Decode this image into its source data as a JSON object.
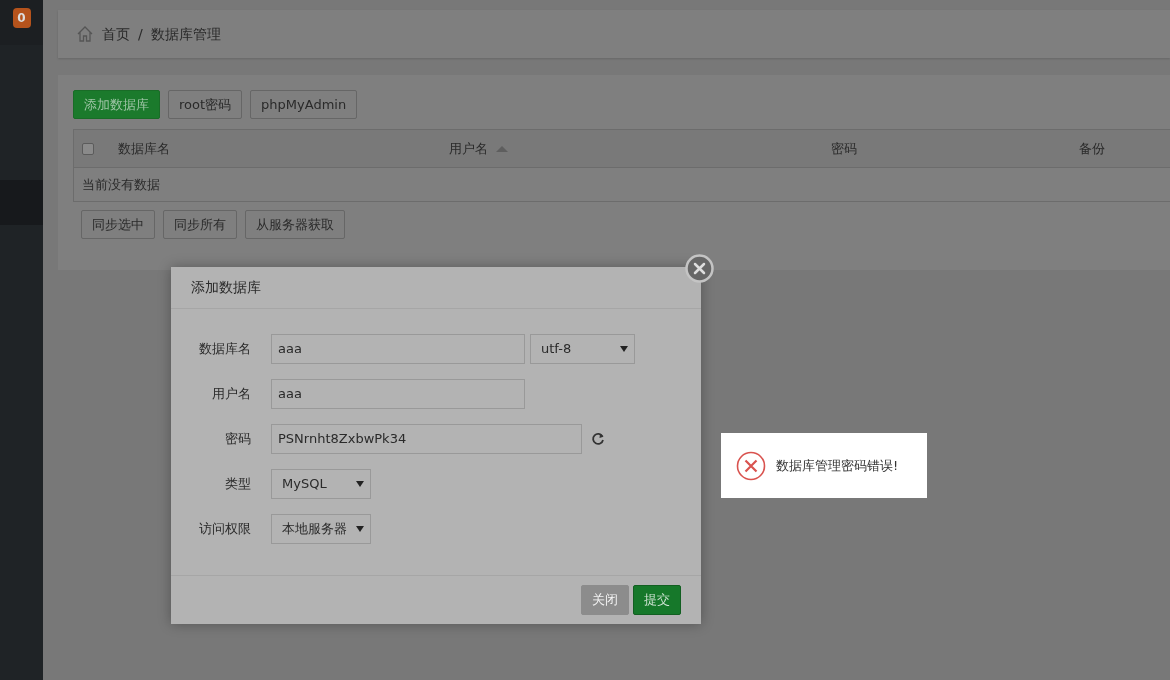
{
  "sidebar": {
    "badge": "0"
  },
  "breadcrumb": {
    "separator": "/",
    "items": [
      "首页",
      "数据库管理"
    ]
  },
  "toolbar": [
    {
      "label": "添加数据库",
      "kind": "primary"
    },
    {
      "label": "root密码",
      "kind": "default"
    },
    {
      "label": "phpMyAdmin",
      "kind": "default"
    }
  ],
  "table": {
    "select_all": {
      "checked": false
    },
    "columns": [
      {
        "label": "数据库名"
      },
      {
        "label": "用户名",
        "sorted": true
      },
      {
        "label": "密码"
      },
      {
        "label": "备份"
      }
    ],
    "empty_text": "当前没有数据"
  },
  "table_actions": [
    "同步选中",
    "同步所有",
    "从服务器获取"
  ],
  "modal": {
    "title": "添加数据库",
    "fields": [
      {
        "label": "数据库名",
        "controls": [
          {
            "kind": "input",
            "value": "aaa"
          },
          {
            "kind": "select",
            "value": "utf-8"
          }
        ]
      },
      {
        "label": "用户名",
        "controls": [
          {
            "kind": "input",
            "value": "aaa"
          }
        ]
      },
      {
        "label": "密码",
        "controls": [
          {
            "kind": "input-wide",
            "value": "PSNrnht8ZxbwPk34"
          },
          {
            "kind": "refresh"
          }
        ]
      },
      {
        "label": "类型",
        "controls": [
          {
            "kind": "select-small",
            "value": "MySQL"
          }
        ]
      },
      {
        "label": "访问权限",
        "controls": [
          {
            "kind": "select-small",
            "value": "本地服务器"
          }
        ]
      }
    ],
    "buttons": [
      {
        "label": "关闭",
        "kind": "default",
        "disabled": true
      },
      {
        "label": "提交",
        "kind": "primary",
        "disabled": false
      }
    ]
  },
  "toast": {
    "kind": "error",
    "message": "数据库管理密码错误!"
  }
}
